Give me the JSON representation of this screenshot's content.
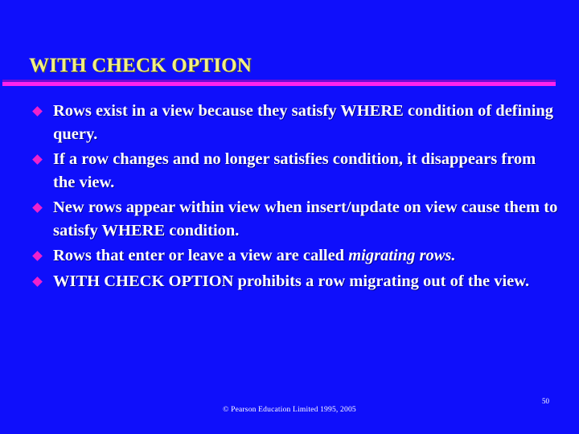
{
  "slide": {
    "background_color": "#0f0ffb",
    "title": "WITH CHECK OPTION",
    "title_color": "#f2ef86",
    "rule_color": "#ff22ee",
    "rule_shadow_color": "#6a0bd6",
    "bullet_color": "#ee22cc",
    "body_color": "#ffffff",
    "bullets": [
      {
        "id": "bullet-1",
        "text": "Rows exist in a view because they satisfy WHERE condition of defining query.",
        "align": "left"
      },
      {
        "id": "bullet-2",
        "text": "If a row changes and no longer satisfies condition, it disappears from the view.",
        "align": "left"
      },
      {
        "id": "bullet-3",
        "text": "New rows appear within view when insert/update on view cause them to satisfy WHERE condition.",
        "align": "left"
      },
      {
        "id": "bullet-4",
        "text_plain": "Rows that enter or leave a view are called ",
        "text_italic": "migrating rows.",
        "align": "justify"
      },
      {
        "id": "bullet-5",
        "text": "WITH CHECK OPTION prohibits a row migrating out of the view.",
        "align": "left"
      }
    ],
    "footer": "© Pearson Education Limited 1995, 2005",
    "page_number": "50"
  }
}
